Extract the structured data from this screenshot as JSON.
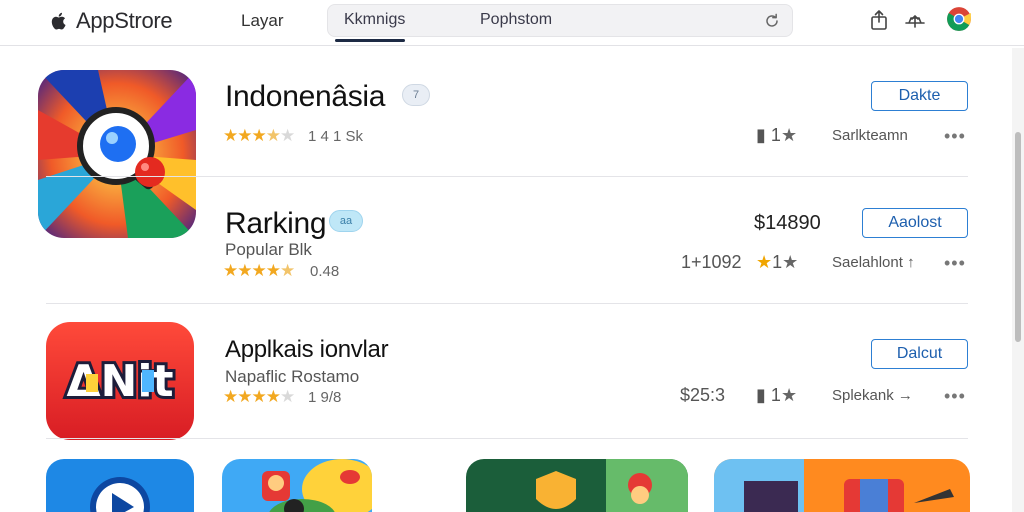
{
  "topbar": {
    "brand": "AppStrore",
    "nav_layar": "Layar",
    "tab_active": "Kkmnigs",
    "search_text": "Pophstom"
  },
  "rows": [
    {
      "title": "Indonenâsia",
      "badge": "7",
      "stars": 3.5,
      "rating_count": "1 4 1 Sk",
      "meta_left": "",
      "meta_rank": "1",
      "seller": "Sarlkteamn",
      "button": "Dakte"
    },
    {
      "title": "Rarking",
      "badge": "aa",
      "subtitle": "Popular Blk",
      "stars": 4.5,
      "rating_count": "0.48",
      "price": "$14890",
      "meta_left": "1+1092",
      "meta_rank": "1",
      "seller": "Saelahlont",
      "seller_arrow": "↑",
      "button": "Aaolost"
    },
    {
      "title": "Applkais ionvlar",
      "subtitle": "Napaflic Rostamo",
      "stars": 4.0,
      "rating_count": "1 9/8",
      "meta_left": "$25:3",
      "meta_rank": "1",
      "seller": "Splekank",
      "seller_arrow": "→",
      "button": "Dalcut"
    }
  ],
  "bottom_tiles": [
    "video-app",
    "adventure-game",
    "shield-app",
    "city-app"
  ],
  "colors": {
    "accent": "#2d7fd3",
    "star": "#f2a820",
    "divider": "#e4e4e8"
  }
}
